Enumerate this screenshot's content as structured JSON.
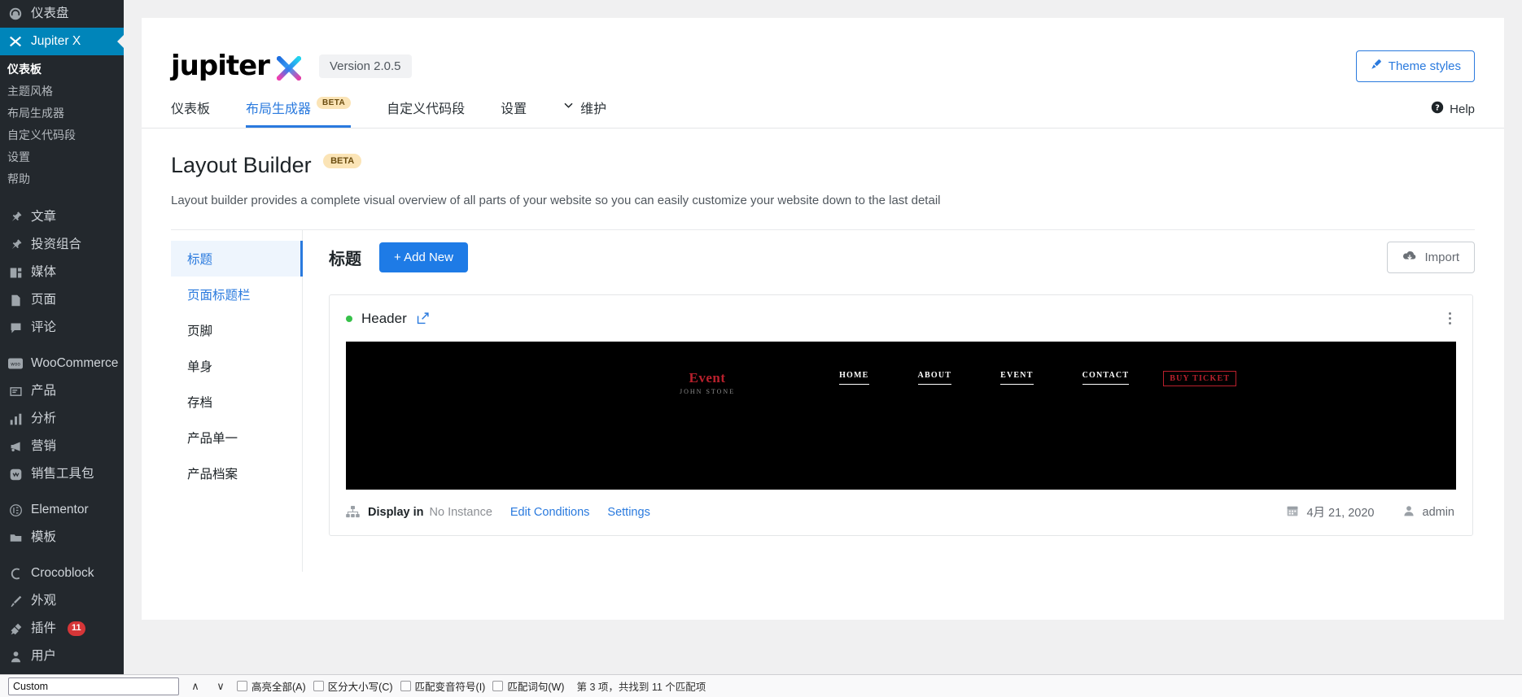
{
  "wp_sidebar": {
    "items": [
      {
        "label": "仪表盘",
        "icon": "dashboard-icon",
        "current": false
      },
      {
        "label": "Jupiter X",
        "icon": "jupiterx-icon",
        "current": true
      }
    ],
    "submenu": [
      {
        "label": "仪表板",
        "active": true
      },
      {
        "label": "主题风格",
        "active": false
      },
      {
        "label": "布局生成器",
        "active": false
      },
      {
        "label": "自定义代码段",
        "active": false
      },
      {
        "label": "设置",
        "active": false
      },
      {
        "label": "帮助",
        "active": false
      }
    ],
    "group2": [
      {
        "label": "文章",
        "icon": "pin-icon"
      },
      {
        "label": "投资组合",
        "icon": "pin-icon"
      },
      {
        "label": "媒体",
        "icon": "media-icon"
      },
      {
        "label": "页面",
        "icon": "page-icon"
      },
      {
        "label": "评论",
        "icon": "comment-icon"
      }
    ],
    "group3": [
      {
        "label": "WooCommerce",
        "icon": "woo-icon"
      },
      {
        "label": "产品",
        "icon": "product-icon"
      },
      {
        "label": "分析",
        "icon": "analytics-icon"
      },
      {
        "label": "营销",
        "icon": "marketing-icon"
      },
      {
        "label": "销售工具包",
        "icon": "sales-kit-icon"
      }
    ],
    "group4": [
      {
        "label": "Elementor",
        "icon": "elementor-icon"
      },
      {
        "label": "模板",
        "icon": "templates-icon"
      }
    ],
    "group5": [
      {
        "label": "Crocoblock",
        "icon": "crocoblock-icon"
      },
      {
        "label": "外观",
        "icon": "appearance-icon"
      },
      {
        "label": "插件",
        "icon": "plugins-icon",
        "count": "11"
      },
      {
        "label": "用户",
        "icon": "users-icon"
      }
    ]
  },
  "brand": {
    "logo_text": "jupiter",
    "logo_x": "X",
    "version": "Version 2.0.5",
    "theme_styles": "Theme styles",
    "accent": "#2a7ade"
  },
  "tabs": {
    "items": [
      {
        "label": "仪表板",
        "badge": "",
        "active": false,
        "chevron": false
      },
      {
        "label": "布局生成器",
        "badge": "BETA",
        "active": true,
        "chevron": false
      },
      {
        "label": "自定义代码段",
        "badge": "",
        "active": false,
        "chevron": false
      },
      {
        "label": "设置",
        "badge": "",
        "active": false,
        "chevron": false
      },
      {
        "label": "维护",
        "badge": "",
        "active": false,
        "chevron": true
      }
    ],
    "help": "Help"
  },
  "page": {
    "title": "Layout Builder",
    "title_badge": "BETA",
    "description": "Layout builder provides a complete visual overview of all parts of your website so you can easily customize your website down to the last detail"
  },
  "builder_nav": {
    "items": [
      {
        "label": "标题",
        "state": "active"
      },
      {
        "label": "页面标题栏",
        "state": "link"
      },
      {
        "label": "页脚",
        "state": "normal"
      },
      {
        "label": "单身",
        "state": "normal"
      },
      {
        "label": "存档",
        "state": "normal"
      },
      {
        "label": "产品单一",
        "state": "normal"
      },
      {
        "label": "产品档案",
        "state": "normal"
      }
    ]
  },
  "builder_main": {
    "section_title": "标题",
    "add_new": "+ Add New",
    "import": "Import"
  },
  "template_card": {
    "name": "Header",
    "status": "active",
    "status_color": "#37c14a",
    "preview": {
      "logo_primary": "Event",
      "logo_secondary": "JOHN STONE",
      "nav": [
        "HOME",
        "ABOUT",
        "EVENT",
        "CONTACT"
      ],
      "cta": "BUY TICKET",
      "bg_color": "#000000",
      "accent_color": "#b8202c"
    },
    "footer": {
      "display_in_label": "Display in",
      "display_in_value": "No Instance",
      "edit_conditions": "Edit Conditions",
      "settings": "Settings",
      "date": "4月 21, 2020",
      "author": "admin"
    }
  },
  "findbar": {
    "value": "Custom",
    "placeholder": "",
    "prev": "∧",
    "next": "∨",
    "checkboxes": [
      {
        "label": "高亮全部(A)",
        "checked": false
      },
      {
        "label": "区分大小写(C)",
        "checked": false
      },
      {
        "label": "匹配变音符号(I)",
        "checked": false
      },
      {
        "label": "匹配词句(W)",
        "checked": false
      }
    ],
    "status": "第 3 项，共找到 11 个匹配项"
  }
}
